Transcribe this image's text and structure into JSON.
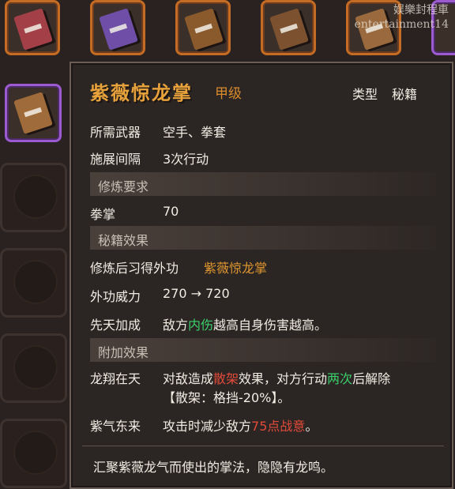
{
  "inventory": {
    "top_books": [
      {
        "icon": "red-book-icon",
        "color": "#a33f47"
      },
      {
        "icon": "purple-book-icon",
        "color": "#6e4ea6"
      },
      {
        "icon": "brown-book-icon",
        "color": "#8a5a2c"
      },
      {
        "icon": "brown-book-icon",
        "color": "#7b5130"
      },
      {
        "icon": "tan-book-icon",
        "color": "#9a6a3e"
      }
    ],
    "selected_book": {
      "icon": "open-scroll-book-icon",
      "color": "#a06b3a"
    }
  },
  "tooltip": {
    "name": "紫薇惊龙掌",
    "grade": "甲级",
    "type_label": "类型",
    "type_value": "秘籍",
    "rows": {
      "weapon_label": "所需武器",
      "weapon_value": "空手、拳套",
      "interval_label": "施展间隔",
      "interval_value": "3次行动"
    },
    "sections": {
      "requirements": "修炼要求",
      "effects": "秘籍效果",
      "extra": "附加效果"
    },
    "requirement": {
      "label": "拳掌",
      "value": "70"
    },
    "learn": {
      "label": "修炼后习得外功",
      "value": "紫薇惊龙掌"
    },
    "power": {
      "label": "外功威力",
      "value": "270 → 720"
    },
    "innate": {
      "label": "先天加成",
      "part1": "敌方",
      "highlight": "内伤",
      "part2": "越高自身伤害越高。"
    },
    "dragon": {
      "label": "龙翔在天",
      "part1": "对敌造成",
      "highlight1": "散架",
      "part2": "效果，对方行动",
      "highlight2": "两次",
      "part3": "后解除",
      "line2": "【散架：格挡-20%】。"
    },
    "purple": {
      "label": "紫气东来",
      "part1": "攻击时减少敌方",
      "highlight": "75点战意",
      "part2": "。"
    },
    "description": "汇聚紫薇龙气而使出的掌法，隐隐有龙鸣。"
  },
  "watermark": {
    "line1": "娱樂封程車",
    "line2": "entertainment14"
  }
}
